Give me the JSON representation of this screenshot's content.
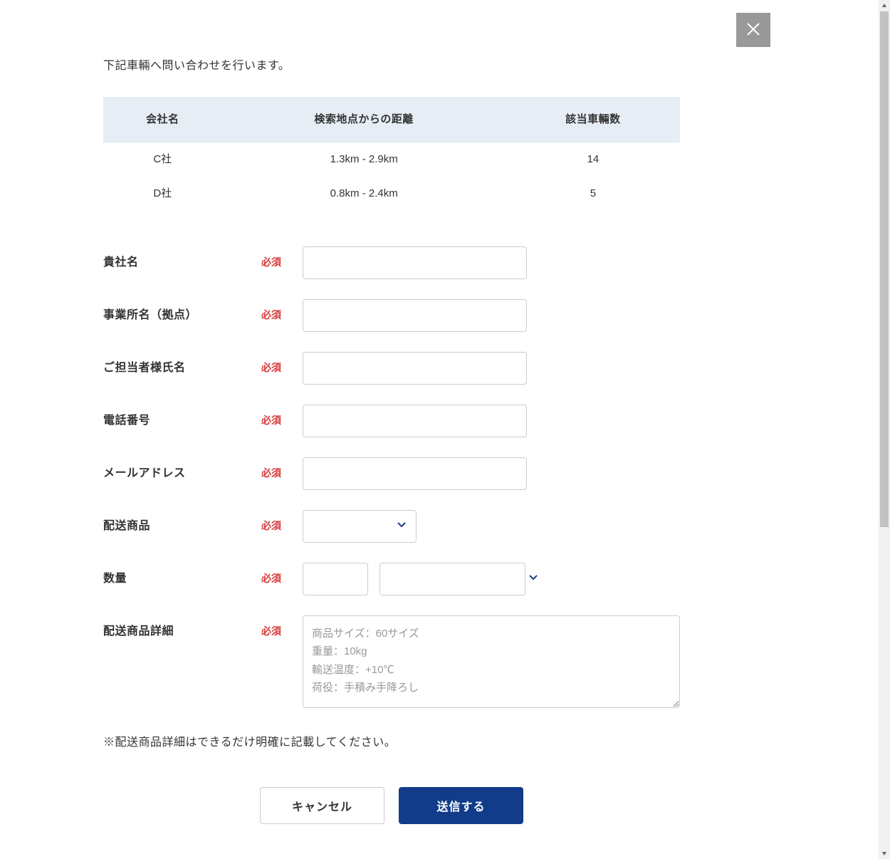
{
  "intro": "下記車輛へ問い合わせを行います。",
  "table": {
    "headers": {
      "company": "会社名",
      "distance": "検索地点からの距離",
      "count": "該当車輛数"
    },
    "rows": [
      {
        "company": "C社",
        "distance": "1.3km - 2.9km",
        "count": "14"
      },
      {
        "company": "D社",
        "distance": "0.8km - 2.4km",
        "count": "5"
      }
    ]
  },
  "required_label": "必須",
  "form": {
    "company_name": {
      "label": "貴社名"
    },
    "branch_name": {
      "label": "事業所名（拠点）"
    },
    "contact_name": {
      "label": "ご担当者様氏名"
    },
    "phone": {
      "label": "電話番号"
    },
    "email": {
      "label": "メールアドレス"
    },
    "product": {
      "label": "配送商品"
    },
    "quantity": {
      "label": "数量"
    },
    "details": {
      "label": "配送商品詳細",
      "placeholder": "商品サイズ：60サイズ\n重量：10kg\n輸送温度：+10℃\n荷役：手積み手降ろし"
    }
  },
  "note": "※配送商品詳細はできるだけ明確に記載してください。",
  "buttons": {
    "cancel": "キャンセル",
    "submit": "送信する"
  }
}
